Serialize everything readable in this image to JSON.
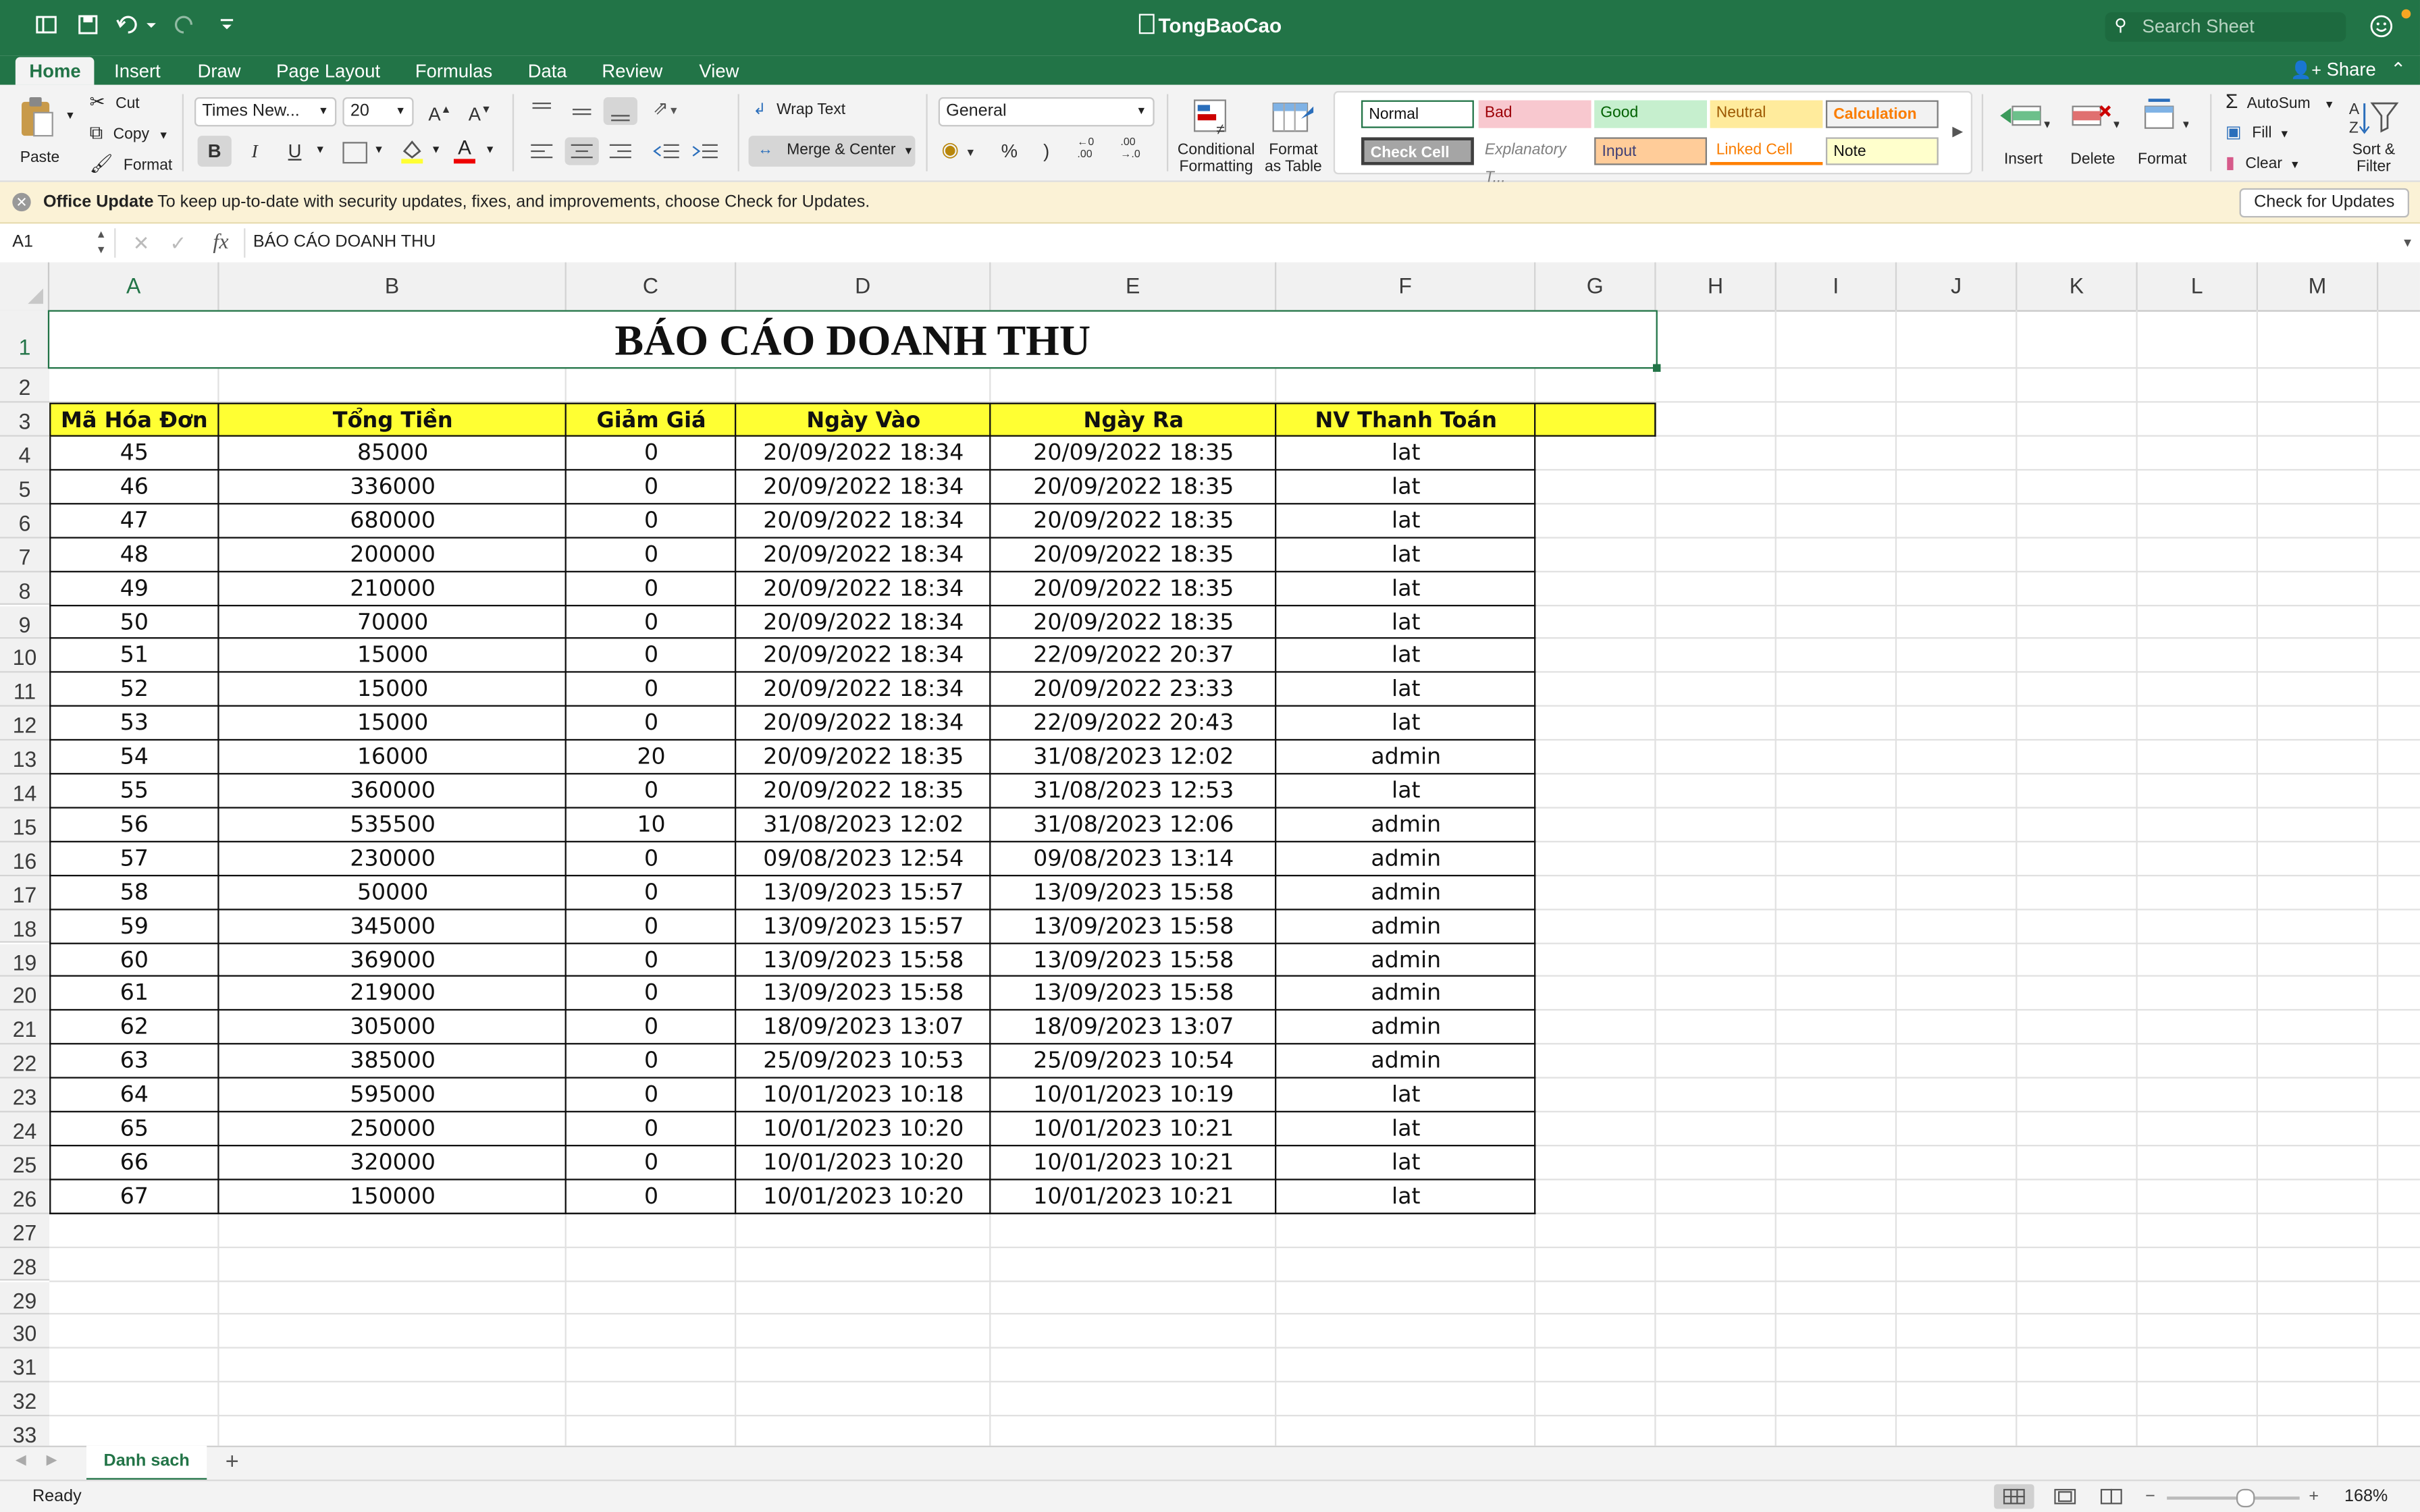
{
  "window": {
    "title": "TongBaoCao",
    "search_placeholder": "Search Sheet"
  },
  "tabs": [
    "Home",
    "Insert",
    "Draw",
    "Page Layout",
    "Formulas",
    "Data",
    "Review",
    "View"
  ],
  "share_label": "Share",
  "ribbon": {
    "paste": "Paste",
    "cut": "Cut",
    "copy": "Copy",
    "format_painter": "Format",
    "font_name": "Times New...",
    "font_size": "20",
    "bold": "B",
    "italic": "I",
    "underline": "U",
    "wrap_text": "Wrap Text",
    "merge_center": "Merge & Center",
    "number_format": "General",
    "percent": "%",
    "comma": ")",
    "cond_format_1": "Conditional",
    "cond_format_2": "Formatting",
    "format_table_1": "Format",
    "format_table_2": "as Table",
    "styles": {
      "normal": "Normal",
      "bad": "Bad",
      "good": "Good",
      "neutral": "Neutral",
      "calculation": "Calculation",
      "check_cell": "Check Cell",
      "explanatory": "Explanatory T...",
      "input": "Input",
      "linked_cell": "Linked Cell",
      "note": "Note"
    },
    "insert": "Insert",
    "delete": "Delete",
    "format": "Format",
    "autosum": "AutoSum",
    "fill": "Fill",
    "clear": "Clear",
    "sort_filter_1": "Sort &",
    "sort_filter_2": "Filter",
    "colors": {
      "green": "#227447",
      "header_yellow": "#ffff33"
    }
  },
  "update_bar": {
    "title": "Office Update",
    "message": "To keep up-to-date with security updates, fixes, and improvements, choose Check for Updates.",
    "button": "Check for Updates"
  },
  "formula_bar": {
    "name_box": "A1",
    "fx": "fx",
    "content": "BÁO CÁO DOANH THU"
  },
  "sheet": {
    "columns": [
      "A",
      "B",
      "C",
      "D",
      "E",
      "F",
      "G",
      "H",
      "I",
      "J",
      "K",
      "L",
      "M"
    ],
    "row_numbers": [
      "1",
      "2",
      "3",
      "4",
      "5",
      "6",
      "7",
      "8",
      "9",
      "10",
      "11",
      "12",
      "13",
      "14",
      "15",
      "16",
      "17",
      "18",
      "19",
      "20",
      "21",
      "22",
      "23",
      "24",
      "25",
      "26",
      "27",
      "28",
      "29",
      "30",
      "31",
      "32",
      "33"
    ],
    "title": "BÁO CÁO DOANH THU",
    "headers": [
      "Mã Hóa Đơn",
      "Tổng Tiền",
      "Giảm Giá",
      "Ngày Vào",
      "Ngày Ra",
      "NV Thanh Toán"
    ],
    "rows": [
      [
        "45",
        "85000",
        "0",
        "20/09/2022 18:34",
        "20/09/2022 18:35",
        "lat"
      ],
      [
        "46",
        "336000",
        "0",
        "20/09/2022 18:34",
        "20/09/2022 18:35",
        "lat"
      ],
      [
        "47",
        "680000",
        "0",
        "20/09/2022 18:34",
        "20/09/2022 18:35",
        "lat"
      ],
      [
        "48",
        "200000",
        "0",
        "20/09/2022 18:34",
        "20/09/2022 18:35",
        "lat"
      ],
      [
        "49",
        "210000",
        "0",
        "20/09/2022 18:34",
        "20/09/2022 18:35",
        "lat"
      ],
      [
        "50",
        "70000",
        "0",
        "20/09/2022 18:34",
        "20/09/2022 18:35",
        "lat"
      ],
      [
        "51",
        "15000",
        "0",
        "20/09/2022 18:34",
        "22/09/2022 20:37",
        "lat"
      ],
      [
        "52",
        "15000",
        "0",
        "20/09/2022 18:34",
        "20/09/2022 23:33",
        "lat"
      ],
      [
        "53",
        "15000",
        "0",
        "20/09/2022 18:34",
        "22/09/2022 20:43",
        "lat"
      ],
      [
        "54",
        "16000",
        "20",
        "20/09/2022 18:35",
        "31/08/2023 12:02",
        "admin"
      ],
      [
        "55",
        "360000",
        "0",
        "20/09/2022 18:35",
        "31/08/2023 12:53",
        "lat"
      ],
      [
        "56",
        "535500",
        "10",
        "31/08/2023 12:02",
        "31/08/2023 12:06",
        "admin"
      ],
      [
        "57",
        "230000",
        "0",
        "09/08/2023 12:54",
        "09/08/2023 13:14",
        "admin"
      ],
      [
        "58",
        "50000",
        "0",
        "13/09/2023 15:57",
        "13/09/2023 15:58",
        "admin"
      ],
      [
        "59",
        "345000",
        "0",
        "13/09/2023 15:57",
        "13/09/2023 15:58",
        "admin"
      ],
      [
        "60",
        "369000",
        "0",
        "13/09/2023 15:58",
        "13/09/2023 15:58",
        "admin"
      ],
      [
        "61",
        "219000",
        "0",
        "13/09/2023 15:58",
        "13/09/2023 15:58",
        "admin"
      ],
      [
        "62",
        "305000",
        "0",
        "18/09/2023 13:07",
        "18/09/2023 13:07",
        "admin"
      ],
      [
        "63",
        "385000",
        "0",
        "25/09/2023 10:53",
        "25/09/2023 10:54",
        "admin"
      ],
      [
        "64",
        "595000",
        "0",
        "10/01/2023 10:18",
        "10/01/2023 10:19",
        "lat"
      ],
      [
        "65",
        "250000",
        "0",
        "10/01/2023 10:20",
        "10/01/2023 10:21",
        "lat"
      ],
      [
        "66",
        "320000",
        "0",
        "10/01/2023 10:20",
        "10/01/2023 10:21",
        "lat"
      ],
      [
        "67",
        "150000",
        "0",
        "10/01/2023 10:20",
        "10/01/2023 10:21",
        "lat"
      ]
    ]
  },
  "sheet_tabs": {
    "active": "Danh sach",
    "add": "+"
  },
  "status": {
    "ready": "Ready",
    "zoom": "168%",
    "zoom_minus": "−",
    "zoom_plus": "+"
  }
}
